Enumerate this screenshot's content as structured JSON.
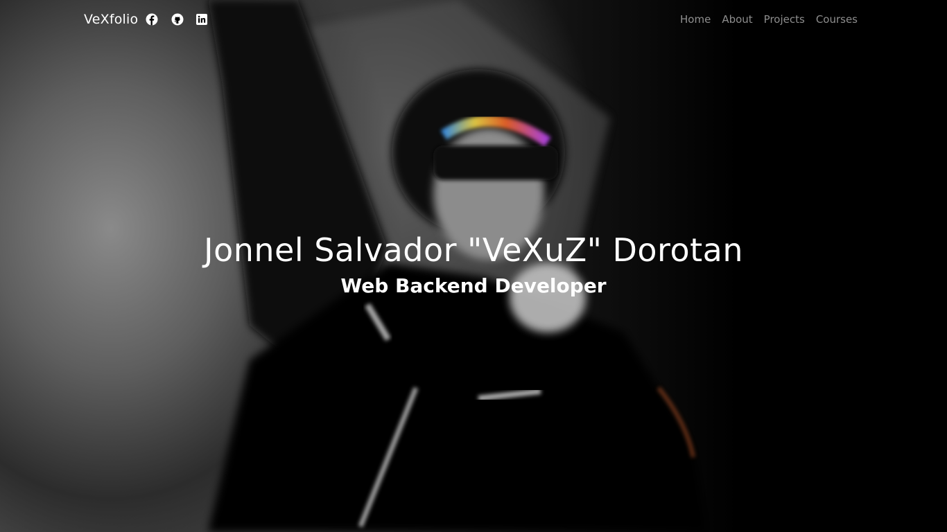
{
  "navbar": {
    "brand": "VeXfolio",
    "social": [
      {
        "name": "facebook",
        "icon": "facebook-icon"
      },
      {
        "name": "github",
        "icon": "github-icon"
      },
      {
        "name": "linkedin",
        "icon": "linkedin-icon"
      }
    ],
    "links": [
      "Home",
      "About",
      "Projects",
      "Courses"
    ]
  },
  "hero": {
    "name": "Jonnel Salvador \"VeXuZ\" Dorotan",
    "role": "Web Backend Developer",
    "background": "blurred black-and-white photo of a person singing into a microphone with one arm raised"
  },
  "colors": {
    "text": "#ffffff",
    "nav_link": "#9a9a9a",
    "background": "#000000"
  }
}
